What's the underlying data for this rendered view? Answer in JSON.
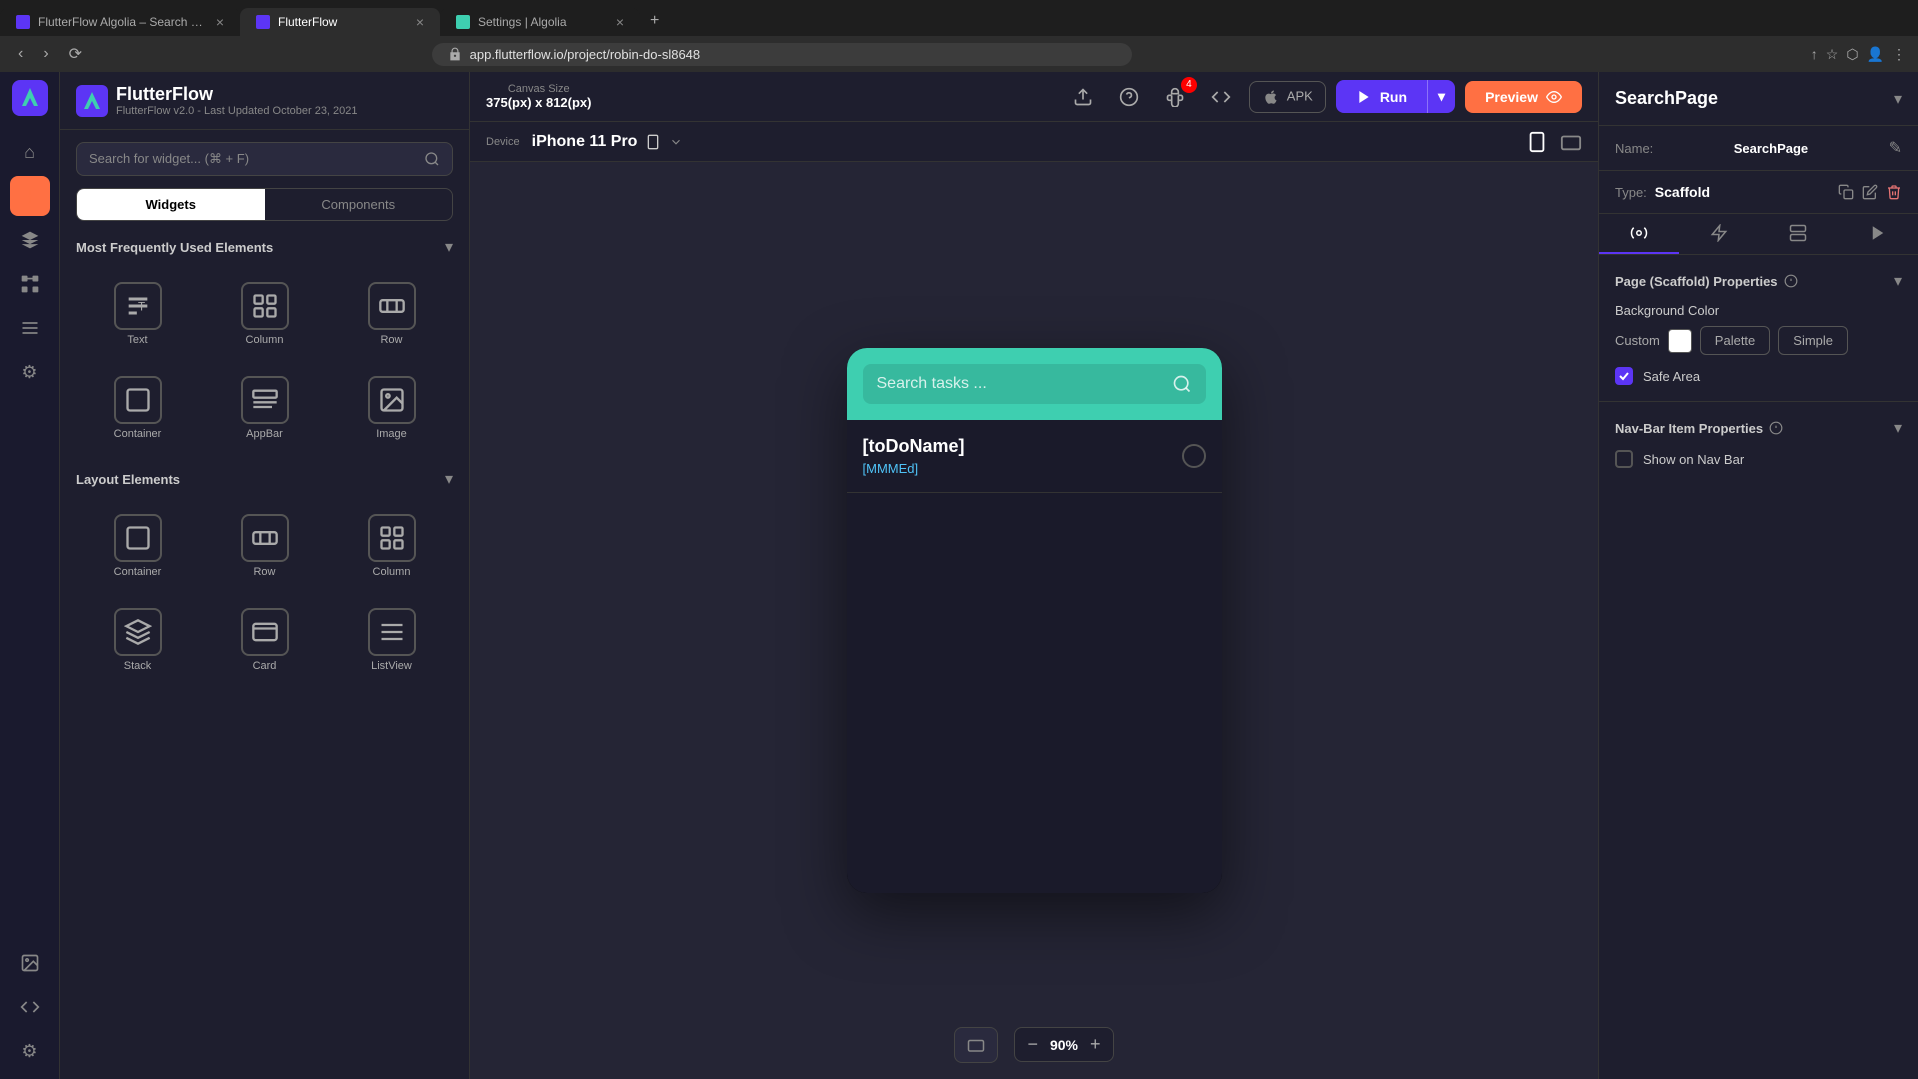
{
  "browser": {
    "tabs": [
      {
        "id": "tab-algolia",
        "title": "FlutterFlow Algolia – Search w...",
        "favicon_color": "#5c35f5",
        "active": false
      },
      {
        "id": "tab-flutterflow",
        "title": "FlutterFlow",
        "favicon_color": "#5c35f5",
        "active": true
      },
      {
        "id": "tab-settings",
        "title": "Settings | Algolia",
        "favicon_color": "#3ecfb0",
        "active": false
      }
    ],
    "new_tab_icon": "+",
    "address": "app.flutterflow.io/project/robin-do-sl8648",
    "nav": {
      "back": "‹",
      "forward": "›",
      "refresh": "⟳"
    }
  },
  "sidebar": {
    "logo_text": "FlutterFlow",
    "subtitle": "FlutterFlow v2.0 - Last Updated October 23, 2021",
    "items": [
      {
        "id": "home",
        "icon": "⌂",
        "label": "Home",
        "active": false
      },
      {
        "id": "build",
        "icon": "◻",
        "label": "Build",
        "active": true
      },
      {
        "id": "layers",
        "icon": "◈",
        "label": "Layers",
        "active": false
      },
      {
        "id": "connect",
        "icon": "⊞",
        "label": "Connect",
        "active": false
      },
      {
        "id": "database",
        "icon": "☰",
        "label": "Database",
        "active": false
      },
      {
        "id": "settings2",
        "icon": "⚙",
        "label": "Settings",
        "active": false
      },
      {
        "id": "media",
        "icon": "🖼",
        "label": "Media",
        "active": false
      },
      {
        "id": "code",
        "icon": "</>",
        "label": "Code",
        "active": false
      },
      {
        "id": "settings3",
        "icon": "⚙",
        "label": "Settings",
        "active": false
      }
    ]
  },
  "widget_panel": {
    "search_placeholder": "Search for widget... (⌘ + F)",
    "tabs": [
      {
        "id": "widgets",
        "label": "Widgets",
        "active": true
      },
      {
        "id": "components",
        "label": "Components",
        "active": false
      }
    ],
    "sections": [
      {
        "id": "most-frequently-used",
        "title": "Most Frequently Used Elements",
        "expanded": true,
        "items": [
          {
            "id": "text",
            "label": "Text"
          },
          {
            "id": "column",
            "label": "Column"
          },
          {
            "id": "row",
            "label": "Row"
          },
          {
            "id": "container",
            "label": "Container"
          },
          {
            "id": "appbar",
            "label": "AppBar"
          },
          {
            "id": "image",
            "label": "Image"
          }
        ]
      },
      {
        "id": "layout-elements",
        "title": "Layout Elements",
        "expanded": true,
        "items": [
          {
            "id": "container2",
            "label": "Container"
          },
          {
            "id": "row2",
            "label": "Row"
          },
          {
            "id": "column2",
            "label": "Column"
          },
          {
            "id": "stack",
            "label": "Stack"
          },
          {
            "id": "card",
            "label": "Card"
          },
          {
            "id": "listview",
            "label": "ListView"
          }
        ]
      }
    ]
  },
  "canvas": {
    "size_label": "Canvas Size",
    "size_value": "375(px) x 812(px)",
    "device_label": "Device",
    "device_name": "iPhone 11 Pro",
    "zoom_level": "90%",
    "phone_content": {
      "search_placeholder": "Search tasks ...",
      "todo_name": "[toDoName]",
      "todo_date": "[MMMEd]"
    }
  },
  "toolbar": {
    "run_label": "Run",
    "preview_label": "Preview",
    "apk_label": "APK",
    "bug_badge": "4"
  },
  "properties": {
    "title": "SearchPage",
    "name_label": "Name:",
    "name_value": "SearchPage",
    "type_label": "Type:",
    "type_value": "Scaffold",
    "section_page_title": "Page (Scaffold) Properties",
    "bg_color_label": "Background Color",
    "bg_options": [
      {
        "id": "custom",
        "label": "Custom",
        "active": true
      },
      {
        "id": "palette",
        "label": "Palette",
        "active": false
      },
      {
        "id": "simple",
        "label": "Simple",
        "active": false
      }
    ],
    "safe_area_label": "Safe Area",
    "safe_area_checked": true,
    "nav_bar_title": "Nav-Bar Item Properties",
    "show_nav_label": "Show on Nav Bar",
    "show_nav_checked": false
  }
}
